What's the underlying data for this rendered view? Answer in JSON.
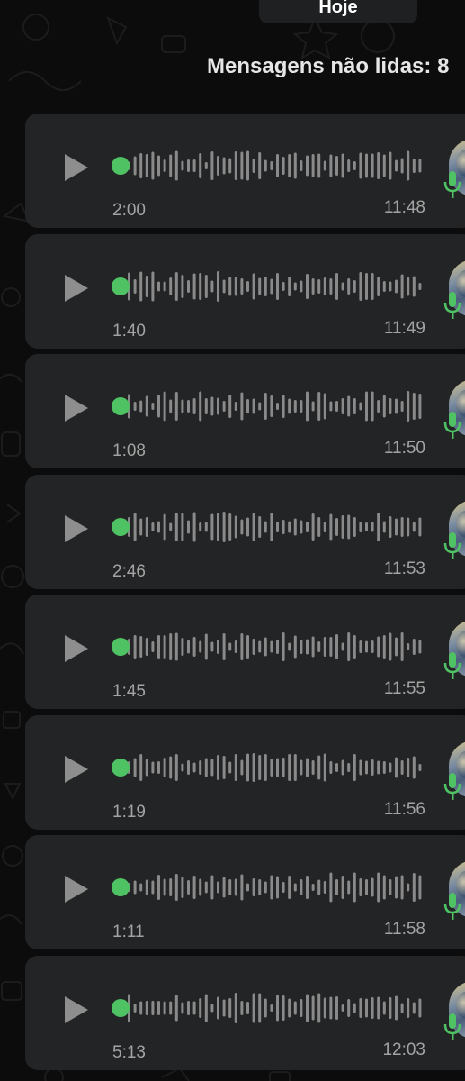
{
  "date_separator": "Hoje",
  "unread_banner": "Mensagens não lidas: 8",
  "colors": {
    "background": "#0c0c0c",
    "bubble": "#232425",
    "accent_green": "#4fc264",
    "waveform": "#8a8a8a",
    "meta_text": "#a3a3a3"
  },
  "icons": {
    "play": "play-icon",
    "mic": "microphone-icon",
    "avatar": "contact-avatar"
  },
  "voice_messages": [
    {
      "duration": "2:00",
      "time": "11:48",
      "played": 0
    },
    {
      "duration": "1:40",
      "time": "11:49",
      "played": 0
    },
    {
      "duration": "1:08",
      "time": "11:50",
      "played": 0
    },
    {
      "duration": "2:46",
      "time": "11:53",
      "played": 0
    },
    {
      "duration": "1:45",
      "time": "11:55",
      "played": 0
    },
    {
      "duration": "1:19",
      "time": "11:56",
      "played": 0
    },
    {
      "duration": "1:11",
      "time": "11:58",
      "played": 0
    },
    {
      "duration": "5:13",
      "time": "12:03",
      "played": 0
    }
  ]
}
